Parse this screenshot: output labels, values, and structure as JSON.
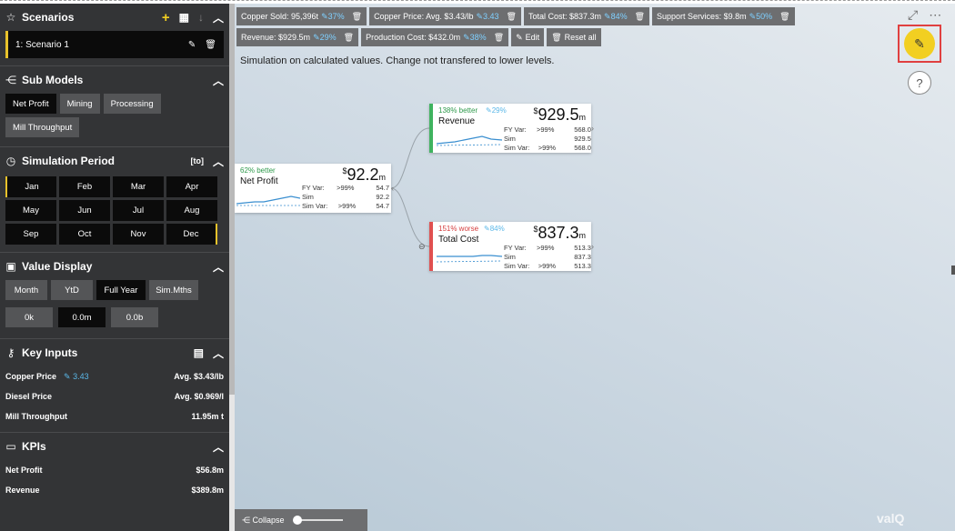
{
  "sidebar": {
    "scenarios": {
      "title": "Scenarios",
      "items": [
        {
          "label": "1: Scenario 1"
        }
      ]
    },
    "sub_models": {
      "title": "Sub Models",
      "buttons": [
        "Net Profit",
        "Mining",
        "Processing",
        "Mill Throughput"
      ],
      "active": "Net Profit"
    },
    "simulation_period": {
      "title": "Simulation Period",
      "tool_label": "[to]",
      "months": [
        "Jan",
        "Feb",
        "Mar",
        "Apr",
        "May",
        "Jun",
        "Jul",
        "Aug",
        "Sep",
        "Oct",
        "Nov",
        "Dec"
      ]
    },
    "value_display": {
      "title": "Value Display",
      "modes": [
        "Month",
        "YtD",
        "Full Year",
        "Sim.Mths"
      ],
      "active_mode": "Full Year",
      "decimals": [
        "0k",
        "0.0m",
        "0.0b"
      ],
      "active_decimal": "0.0m"
    },
    "key_inputs": {
      "title": "Key Inputs",
      "rows": [
        {
          "label": "Copper Price",
          "edit": "3.43",
          "value": "Avg. $3.43/lb"
        },
        {
          "label": "Diesel Price",
          "edit": "",
          "value": "Avg. $0.969/l"
        },
        {
          "label": "Mill Throughput",
          "edit": "",
          "value": "11.95m t"
        }
      ]
    },
    "kpis": {
      "title": "KPIs",
      "rows": [
        {
          "label": "Net Profit",
          "value": "$56.8m"
        },
        {
          "label": "Revenue",
          "value": "$389.8m"
        }
      ]
    }
  },
  "chips": [
    {
      "text": "Copper Sold: 95,396t",
      "pct": "37%"
    },
    {
      "text": "Copper Price: Avg. $3.43/lb",
      "pct": "3.43"
    },
    {
      "text": "Total Cost: $837.3m",
      "pct": "84%"
    },
    {
      "text": "Support Services: $9.8m",
      "pct": "50%"
    },
    {
      "text": "Revenue: $929.5m",
      "pct": "29%"
    },
    {
      "text": "Production Cost: $432.0m",
      "pct": "38%"
    }
  ],
  "chip_actions": {
    "edit": "Edit",
    "reset": "Reset all"
  },
  "sim_note": "Simulation on calculated values. Change not transfered to lower levels.",
  "help_label": "?",
  "nodes": {
    "net_profit": {
      "name": "Net Profit",
      "variance": "62% better",
      "value": "92.2",
      "unit": "m",
      "rows": [
        [
          "FY Var:",
          ">99%",
          "54.7"
        ],
        [
          "Sim",
          "",
          "92.2"
        ],
        [
          "Sim Var:",
          ">99%",
          "54.7"
        ]
      ]
    },
    "revenue": {
      "name": "Revenue",
      "variance": "138% better",
      "edit": "29%",
      "value": "929.5",
      "unit": "m",
      "rows": [
        [
          "FY Var:",
          ">99%",
          "568.0"
        ],
        [
          "Sim",
          "",
          "929.5"
        ],
        [
          "Sim Var:",
          ">99%",
          "568.0"
        ]
      ]
    },
    "total_cost": {
      "name": "Total Cost",
      "variance": "151% worse",
      "edit": "84%",
      "value": "837.3",
      "unit": "m",
      "rows": [
        [
          "FY Var:",
          ">99%",
          "513.3"
        ],
        [
          "Sim",
          "",
          "837.3"
        ],
        [
          "Sim Var:",
          ">99%",
          "513.3"
        ]
      ]
    }
  },
  "collapse_label": "Collapse",
  "brand": "valQ",
  "colors": {
    "accent": "#f2cf21",
    "better": "#3fb35f",
    "worse": "#e05050",
    "sidebar": "#333436"
  }
}
